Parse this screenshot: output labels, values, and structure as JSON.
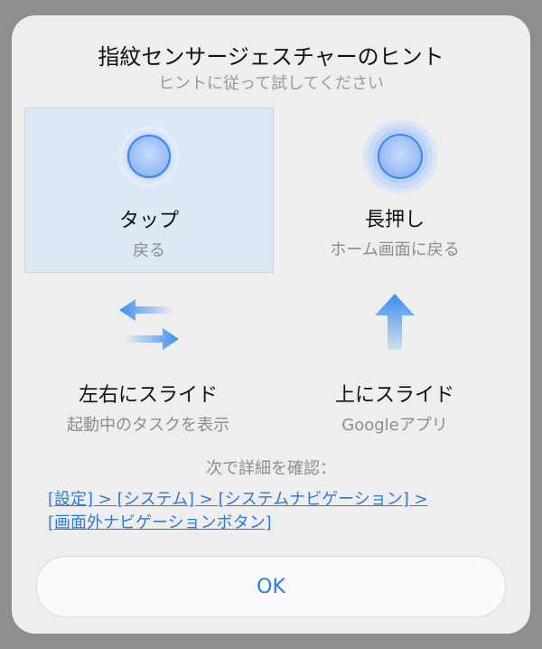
{
  "dialog": {
    "title": "指紋センサージェスチャーのヒント",
    "subtitle": "ヒントに従って試してください"
  },
  "gestures": [
    {
      "name": "タップ",
      "description": "戻る",
      "icon": "tap-circle-icon"
    },
    {
      "name": "長押し",
      "description": "ホーム画面に戻る",
      "icon": "long-press-circle-icon"
    },
    {
      "name": "左右にスライド",
      "description": "起動中のタスクを表示",
      "icon": "swap-arrows-icon"
    },
    {
      "name": "上にスライド",
      "description": "Googleアプリ",
      "icon": "arrow-up-icon"
    }
  ],
  "info": {
    "label": "次で詳細を確認：",
    "link_line1": "[設定] > [システム] > [システムナビゲーション] >",
    "link_line2": "[画面外ナビゲーションボタン]"
  },
  "ok_label": "OK",
  "colors": {
    "accent": "#2a7bd8",
    "selected_tile": "#dde8f5",
    "dialog_bg": "#eeeeee",
    "overlay": "#8e8e8e"
  }
}
